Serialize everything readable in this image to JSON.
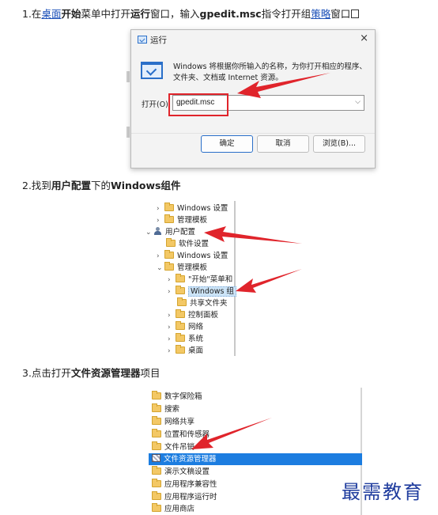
{
  "steps": {
    "s1": {
      "prefix": "1.在",
      "link1": "桌面",
      "b1": "开始",
      "t1": "菜单中打开",
      "b2": "运行",
      "t2": "窗口，输入",
      "b3": "gpedit.msc",
      "t3": "指令打开组",
      "link2": "策略",
      "t4": "窗口"
    },
    "s2": {
      "prefix": "2.找到",
      "b1": "用户配置",
      "t1": "下的",
      "b2": "Windows组件"
    },
    "s3": {
      "prefix": "3.点击打开",
      "b1": "文件资源管理器",
      "t1": "项目"
    }
  },
  "run_dialog": {
    "title": "运行",
    "close": "×",
    "description": "Windows 将根据你所输入的名称，为你打开相应的程序、文件夹、文档或 Internet 资源。",
    "open_label": "打开(O):",
    "input_value": "gpedit.msc",
    "buttons": {
      "ok": "确定",
      "cancel": "取消",
      "browse": "浏览(B)..."
    }
  },
  "tree2": {
    "windows_settings": "Windows 设置",
    "admin_templates": "管理模板",
    "user_config": "用户配置",
    "software_settings": "软件设置",
    "windows_settings_2": "Windows 设置",
    "admin_templates_2": "管理模板",
    "start_menu": "\"开始\"菜单和",
    "windows_components": "Windows 组",
    "shared_folders": "共享文件夹",
    "control_panel": "控制面板",
    "network": "网络",
    "system": "系统",
    "desktop": "桌面"
  },
  "tree3": [
    {
      "label": "数字保险箱",
      "icon": "folder"
    },
    {
      "label": "搜索",
      "icon": "folder"
    },
    {
      "label": "网络共享",
      "icon": "folder"
    },
    {
      "label": "位置和传感器",
      "icon": "folder"
    },
    {
      "label": "文件吊销",
      "icon": "folder"
    },
    {
      "label": "文件资源管理器",
      "icon": "grid",
      "selected": true
    },
    {
      "label": "演示文稿设置",
      "icon": "folder"
    },
    {
      "label": "应用程序兼容性",
      "icon": "folder"
    },
    {
      "label": "应用程序运行时",
      "icon": "folder"
    },
    {
      "label": "应用商店",
      "icon": "folder"
    }
  ],
  "watermark": "最需教育",
  "colors": {
    "arrow": "#e0242b",
    "highlight": "#1c7de0",
    "link": "#1a4fb8"
  }
}
